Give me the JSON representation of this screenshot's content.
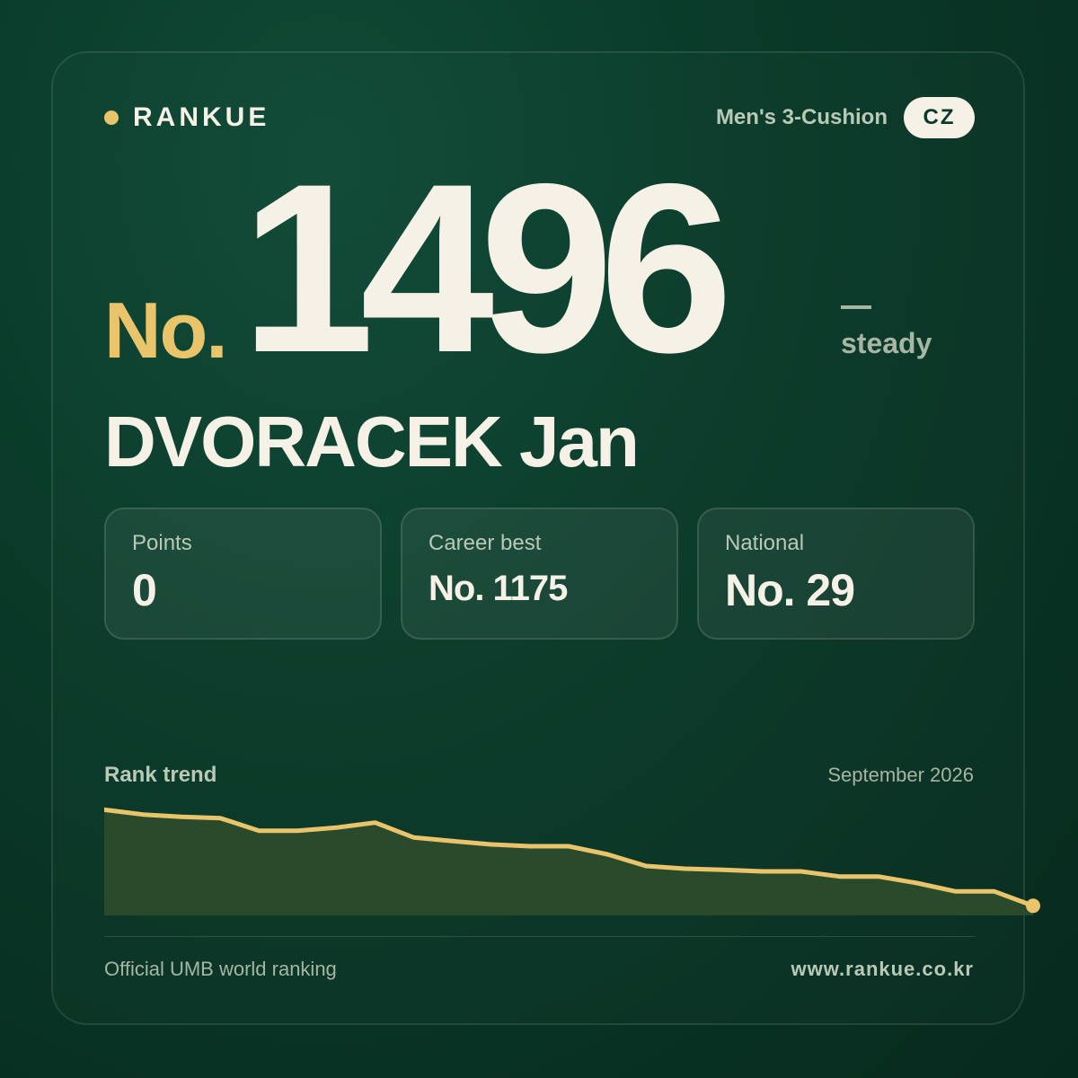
{
  "brand": {
    "name": "RANKUE",
    "accent_color": "#e9c46a"
  },
  "header": {
    "category": "Men's 3-Cushion",
    "country_code": "CZ"
  },
  "ranking": {
    "prefix": "No.",
    "number": "1496",
    "trend_symbol": "—",
    "trend_label": "steady"
  },
  "player": {
    "name": "DVORACEK Jan"
  },
  "stats": [
    {
      "label": "Points",
      "value": "0"
    },
    {
      "label": "Career best",
      "value": "No. 1175"
    },
    {
      "label": "National",
      "value": "No. 29"
    }
  ],
  "trend": {
    "title": "Rank trend",
    "date": "September 2026"
  },
  "chart_data": {
    "type": "area",
    "series": [
      {
        "values": [
          1175,
          1191,
          1199,
          1203,
          1245,
          1245,
          1235,
          1218,
          1268,
          1280,
          1291,
          1297,
          1297,
          1324,
          1363,
          1372,
          1376,
          1381,
          1381,
          1398,
          1398,
          1420,
          1448,
          1448,
          1496
        ]
      }
    ],
    "ylim": [
      1150,
      1510
    ],
    "inverted_y": true,
    "line_color": "#e9c46a",
    "fill_color": "#2a4a2c"
  },
  "footer": {
    "left": "Official UMB world ranking",
    "right": "www.rankue.co.kr"
  }
}
